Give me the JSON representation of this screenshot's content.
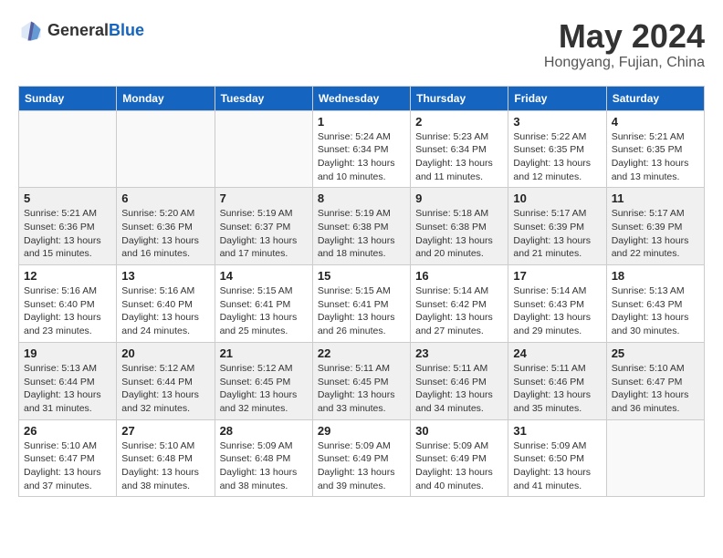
{
  "header": {
    "logo_general": "General",
    "logo_blue": "Blue",
    "main_title": "May 2024",
    "subtitle": "Hongyang, Fujian, China"
  },
  "days_of_week": [
    "Sunday",
    "Monday",
    "Tuesday",
    "Wednesday",
    "Thursday",
    "Friday",
    "Saturday"
  ],
  "weeks": [
    [
      {
        "day": "",
        "info": ""
      },
      {
        "day": "",
        "info": ""
      },
      {
        "day": "",
        "info": ""
      },
      {
        "day": "1",
        "info": "Sunrise: 5:24 AM\nSunset: 6:34 PM\nDaylight: 13 hours\nand 10 minutes."
      },
      {
        "day": "2",
        "info": "Sunrise: 5:23 AM\nSunset: 6:34 PM\nDaylight: 13 hours\nand 11 minutes."
      },
      {
        "day": "3",
        "info": "Sunrise: 5:22 AM\nSunset: 6:35 PM\nDaylight: 13 hours\nand 12 minutes."
      },
      {
        "day": "4",
        "info": "Sunrise: 5:21 AM\nSunset: 6:35 PM\nDaylight: 13 hours\nand 13 minutes."
      }
    ],
    [
      {
        "day": "5",
        "info": "Sunrise: 5:21 AM\nSunset: 6:36 PM\nDaylight: 13 hours\nand 15 minutes."
      },
      {
        "day": "6",
        "info": "Sunrise: 5:20 AM\nSunset: 6:36 PM\nDaylight: 13 hours\nand 16 minutes."
      },
      {
        "day": "7",
        "info": "Sunrise: 5:19 AM\nSunset: 6:37 PM\nDaylight: 13 hours\nand 17 minutes."
      },
      {
        "day": "8",
        "info": "Sunrise: 5:19 AM\nSunset: 6:38 PM\nDaylight: 13 hours\nand 18 minutes."
      },
      {
        "day": "9",
        "info": "Sunrise: 5:18 AM\nSunset: 6:38 PM\nDaylight: 13 hours\nand 20 minutes."
      },
      {
        "day": "10",
        "info": "Sunrise: 5:17 AM\nSunset: 6:39 PM\nDaylight: 13 hours\nand 21 minutes."
      },
      {
        "day": "11",
        "info": "Sunrise: 5:17 AM\nSunset: 6:39 PM\nDaylight: 13 hours\nand 22 minutes."
      }
    ],
    [
      {
        "day": "12",
        "info": "Sunrise: 5:16 AM\nSunset: 6:40 PM\nDaylight: 13 hours\nand 23 minutes."
      },
      {
        "day": "13",
        "info": "Sunrise: 5:16 AM\nSunset: 6:40 PM\nDaylight: 13 hours\nand 24 minutes."
      },
      {
        "day": "14",
        "info": "Sunrise: 5:15 AM\nSunset: 6:41 PM\nDaylight: 13 hours\nand 25 minutes."
      },
      {
        "day": "15",
        "info": "Sunrise: 5:15 AM\nSunset: 6:41 PM\nDaylight: 13 hours\nand 26 minutes."
      },
      {
        "day": "16",
        "info": "Sunrise: 5:14 AM\nSunset: 6:42 PM\nDaylight: 13 hours\nand 27 minutes."
      },
      {
        "day": "17",
        "info": "Sunrise: 5:14 AM\nSunset: 6:43 PM\nDaylight: 13 hours\nand 29 minutes."
      },
      {
        "day": "18",
        "info": "Sunrise: 5:13 AM\nSunset: 6:43 PM\nDaylight: 13 hours\nand 30 minutes."
      }
    ],
    [
      {
        "day": "19",
        "info": "Sunrise: 5:13 AM\nSunset: 6:44 PM\nDaylight: 13 hours\nand 31 minutes."
      },
      {
        "day": "20",
        "info": "Sunrise: 5:12 AM\nSunset: 6:44 PM\nDaylight: 13 hours\nand 32 minutes."
      },
      {
        "day": "21",
        "info": "Sunrise: 5:12 AM\nSunset: 6:45 PM\nDaylight: 13 hours\nand 32 minutes."
      },
      {
        "day": "22",
        "info": "Sunrise: 5:11 AM\nSunset: 6:45 PM\nDaylight: 13 hours\nand 33 minutes."
      },
      {
        "day": "23",
        "info": "Sunrise: 5:11 AM\nSunset: 6:46 PM\nDaylight: 13 hours\nand 34 minutes."
      },
      {
        "day": "24",
        "info": "Sunrise: 5:11 AM\nSunset: 6:46 PM\nDaylight: 13 hours\nand 35 minutes."
      },
      {
        "day": "25",
        "info": "Sunrise: 5:10 AM\nSunset: 6:47 PM\nDaylight: 13 hours\nand 36 minutes."
      }
    ],
    [
      {
        "day": "26",
        "info": "Sunrise: 5:10 AM\nSunset: 6:47 PM\nDaylight: 13 hours\nand 37 minutes."
      },
      {
        "day": "27",
        "info": "Sunrise: 5:10 AM\nSunset: 6:48 PM\nDaylight: 13 hours\nand 38 minutes."
      },
      {
        "day": "28",
        "info": "Sunrise: 5:09 AM\nSunset: 6:48 PM\nDaylight: 13 hours\nand 38 minutes."
      },
      {
        "day": "29",
        "info": "Sunrise: 5:09 AM\nSunset: 6:49 PM\nDaylight: 13 hours\nand 39 minutes."
      },
      {
        "day": "30",
        "info": "Sunrise: 5:09 AM\nSunset: 6:49 PM\nDaylight: 13 hours\nand 40 minutes."
      },
      {
        "day": "31",
        "info": "Sunrise: 5:09 AM\nSunset: 6:50 PM\nDaylight: 13 hours\nand 41 minutes."
      },
      {
        "day": "",
        "info": ""
      }
    ]
  ]
}
